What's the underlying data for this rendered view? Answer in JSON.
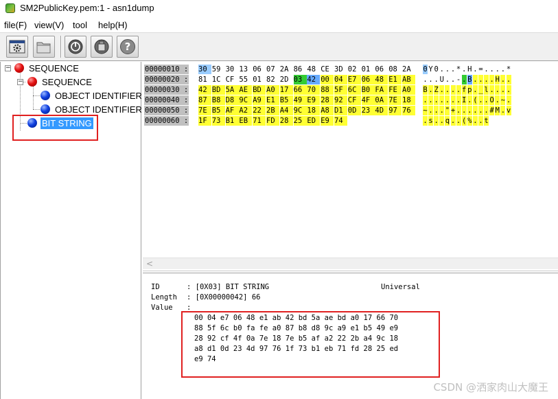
{
  "window": {
    "title": "SM2PublicKey.pem:1 - asn1dump"
  },
  "menu": [
    "file(F)",
    "view(V)",
    "tool",
    "help(H)"
  ],
  "toolbar": {
    "buttons": [
      "settings-icon",
      "folder-open-icon",
      "power-icon",
      "info-icon",
      "help-icon"
    ]
  },
  "tree": {
    "nodes": [
      {
        "label": "SEQUENCE",
        "color": "red",
        "level": 0
      },
      {
        "label": "SEQUENCE",
        "color": "red",
        "level": 1
      },
      {
        "label": "OBJECT IDENTIFIER",
        "color": "blue",
        "level": 2
      },
      {
        "label": "OBJECT IDENTIFIER",
        "color": "blue",
        "level": 2
      },
      {
        "label": "BIT STRING",
        "color": "blue",
        "level": 1,
        "selected": true
      }
    ]
  },
  "hex": {
    "rows": [
      {
        "addr": "00000010 :",
        "bytes": [
          "30",
          "59",
          "30",
          "13",
          "06",
          "07",
          "2A",
          "86",
          "48",
          "CE",
          "3D",
          "02",
          "01",
          "06",
          "08",
          "2A"
        ],
        "ascii": "0Y0...*.H.=....*"
      },
      {
        "addr": "00000020 :",
        "bytes": [
          "81",
          "1C",
          "CF",
          "55",
          "01",
          "82",
          "2D",
          "03",
          "42",
          "00",
          "04",
          "E7",
          "06",
          "48",
          "E1",
          "AB"
        ],
        "ascii": "...U..-.B....H.."
      },
      {
        "addr": "00000030 :",
        "bytes": [
          "42",
          "BD",
          "5A",
          "AE",
          "BD",
          "A0",
          "17",
          "66",
          "70",
          "88",
          "5F",
          "6C",
          "B0",
          "FA",
          "FE",
          "A0"
        ],
        "ascii": "B.Z....fp._l...."
      },
      {
        "addr": "00000040 :",
        "bytes": [
          "87",
          "B8",
          "D8",
          "9C",
          "A9",
          "E1",
          "B5",
          "49",
          "E9",
          "28",
          "92",
          "CF",
          "4F",
          "0A",
          "7E",
          "18"
        ],
        "ascii": ".......I.(..O.~."
      },
      {
        "addr": "00000050 :",
        "bytes": [
          "7E",
          "B5",
          "AF",
          "A2",
          "22",
          "2B",
          "A4",
          "9C",
          "18",
          "A8",
          "D1",
          "0D",
          "23",
          "4D",
          "97",
          "76"
        ],
        "ascii": "~...\"+......#M.v"
      },
      {
        "addr": "00000060 :",
        "bytes": [
          "1F",
          "73",
          "B1",
          "EB",
          "71",
          "FD",
          "28",
          "25",
          "ED",
          "E9",
          "74"
        ],
        "ascii": ".s..q..(%..t"
      }
    ]
  },
  "colors": {
    "highlight_yellow": "#ffff33",
    "highlight_blue": "#99ccff",
    "highlight_green": "#33cc33",
    "selection": "#3399ff",
    "annotation_red": "#e02020"
  },
  "detail": {
    "id_label": "ID",
    "id_value": ": [0X03] BIT STRING",
    "class_value": "Universal",
    "length_label": "Length",
    "length_value": ": [0X00000042] 66",
    "value_label": "Value",
    "value_colon": ":",
    "value_lines": [
      "00 04 e7 06 48 e1 ab 42 bd 5a ae bd a0 17 66 70",
      "88 5f 6c b0 fa fe a0 87 b8 d8 9c a9 e1 b5 49 e9",
      "28 92 cf 4f 0a 7e 18 7e b5 af a2 22 2b a4 9c 18",
      "a8 d1 0d 23 4d 97 76 1f 73 b1 eb 71 fd 28 25 ed",
      "e9 74"
    ]
  },
  "watermark": "CSDN @洒家肉山大魔王"
}
